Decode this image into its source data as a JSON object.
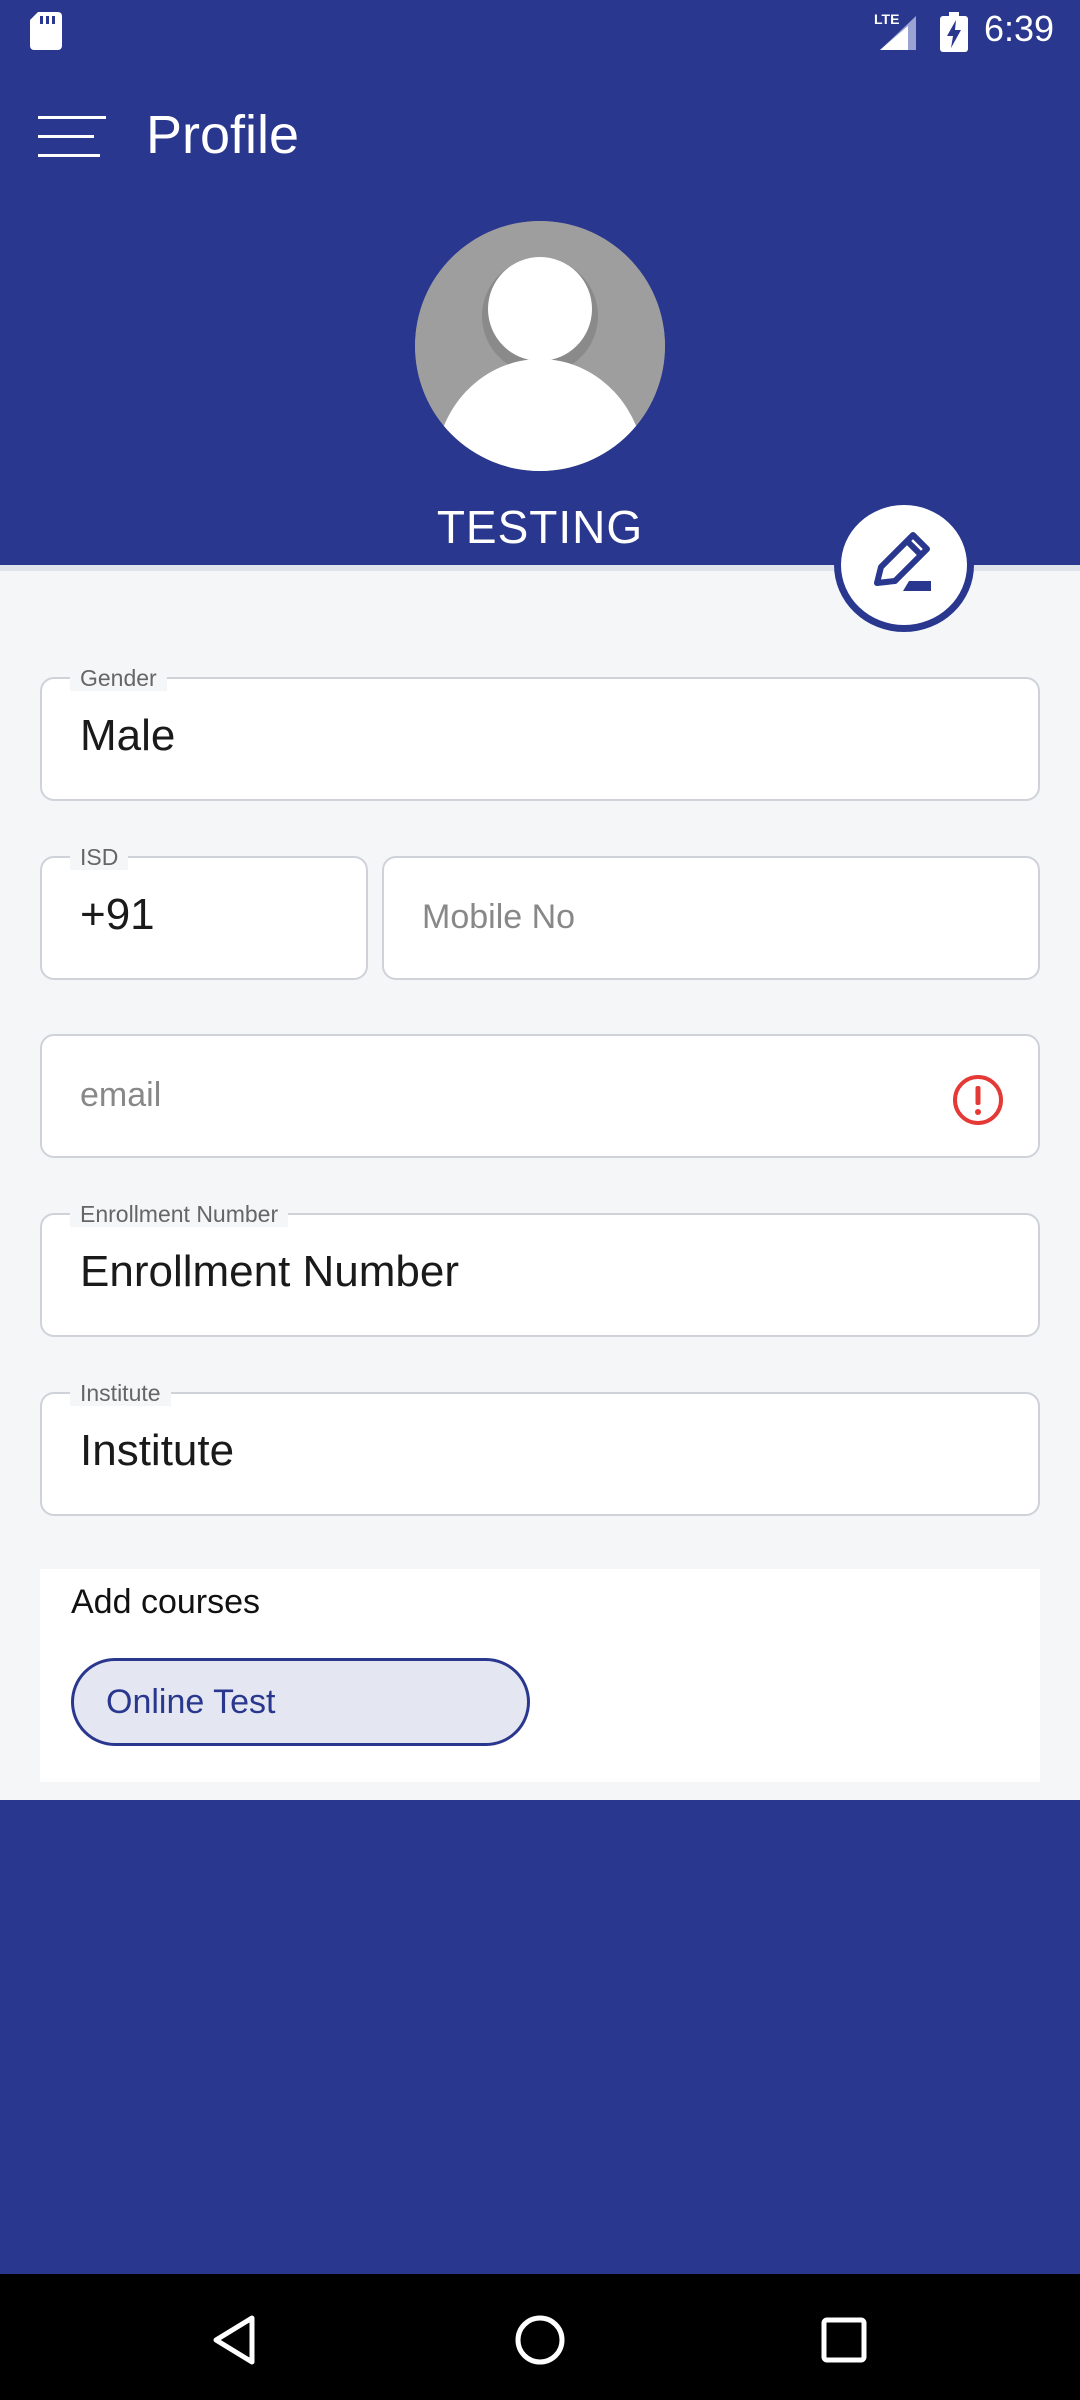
{
  "status_bar": {
    "time": "6:39",
    "network": "LTE"
  },
  "app_bar": {
    "title": "Profile"
  },
  "profile": {
    "name": "TESTING"
  },
  "form": {
    "gender": {
      "label": "Gender",
      "value": "Male"
    },
    "isd": {
      "label": "ISD",
      "value": "+91"
    },
    "mobile": {
      "placeholder": "Mobile No"
    },
    "email": {
      "placeholder": "email"
    },
    "enrollment": {
      "label": "Enrollment Number",
      "value": "Enrollment Number"
    },
    "institute": {
      "label": "Institute",
      "value": "Institute"
    }
  },
  "courses": {
    "title": "Add courses",
    "items": [
      {
        "label": "Online Test"
      }
    ]
  },
  "colors": {
    "primary": "#29378e",
    "background": "#f4f6f8",
    "error": "#e53935",
    "chip_fill": "#e4e7f1"
  },
  "icons": [
    "sd-card-icon",
    "lte-signal-icon",
    "battery-charging-icon",
    "menu-icon",
    "avatar-placeholder-icon",
    "edit-pencil-icon",
    "error-alert-icon",
    "back-icon",
    "home-icon",
    "recents-icon"
  ]
}
